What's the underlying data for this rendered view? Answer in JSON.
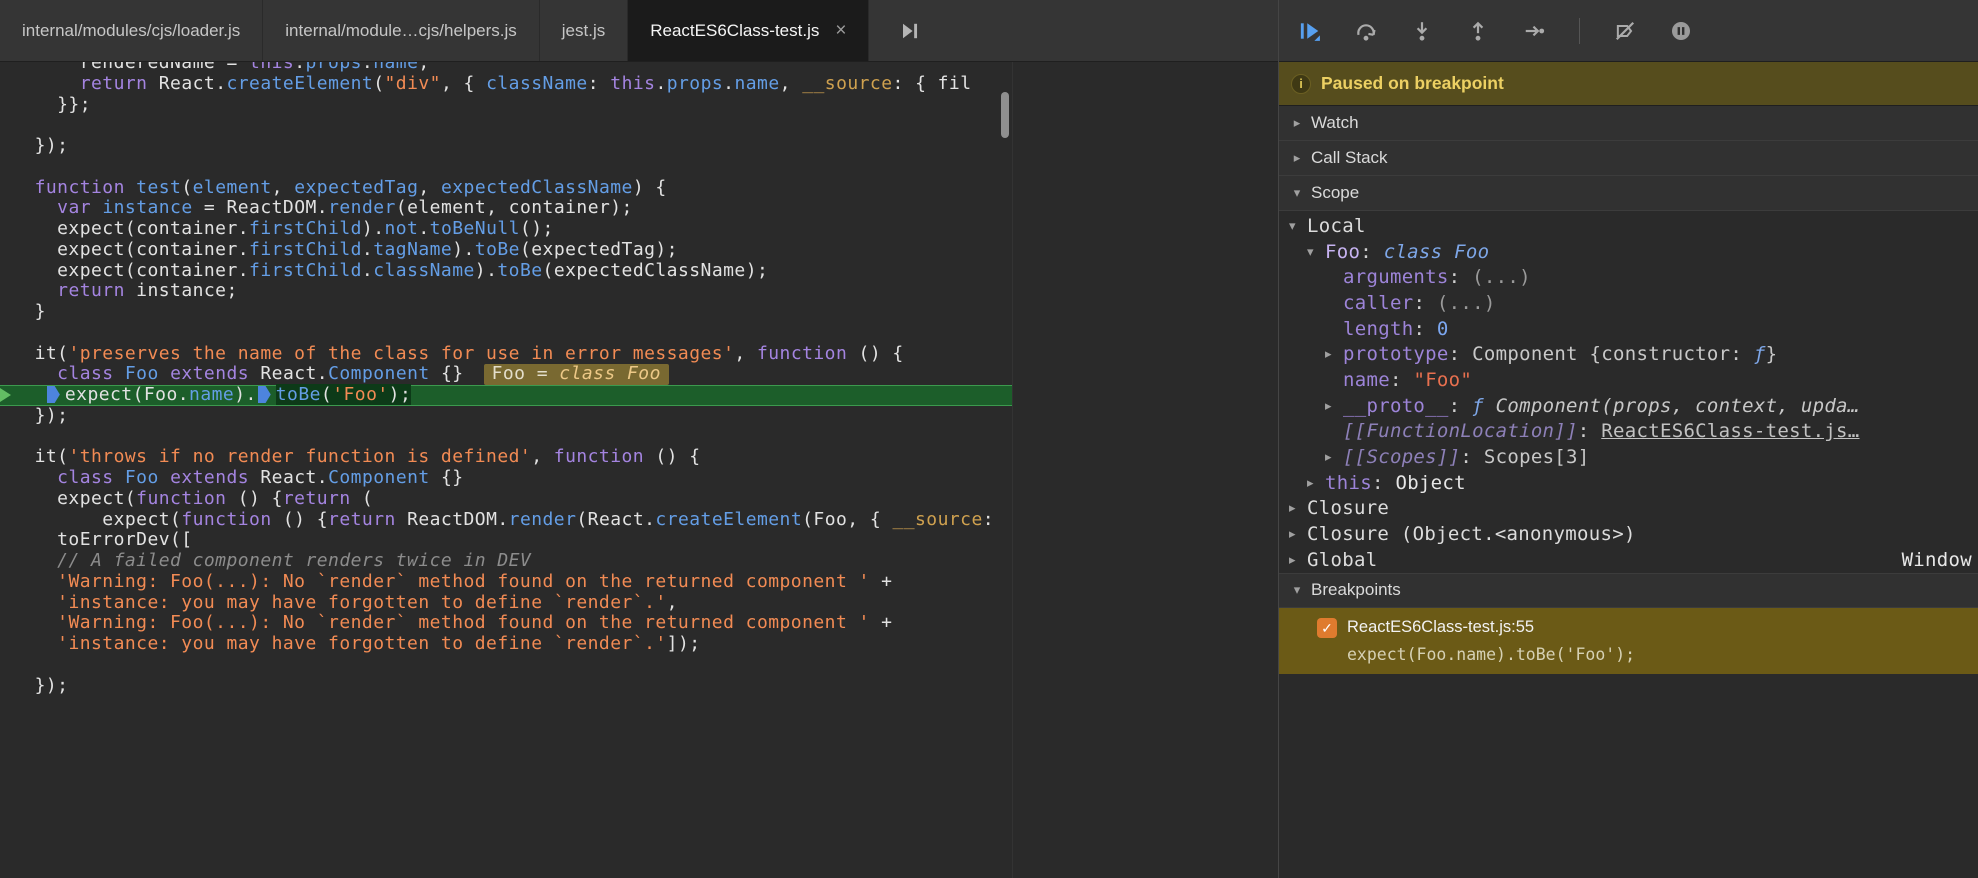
{
  "tabs": [
    {
      "label": "internal/modules/cjs/loader.js",
      "active": false,
      "closable": false
    },
    {
      "label": "internal/module…cjs/helpers.js",
      "active": false,
      "closable": false
    },
    {
      "label": "jest.js",
      "active": false,
      "closable": false
    },
    {
      "label": "ReactES6Class-test.js",
      "active": true,
      "closable": true
    }
  ],
  "tabstrip": {
    "overflow_icon": "more-tabs-icon",
    "close_glyph": "×"
  },
  "editor": {
    "lines": [
      {
        "tokens": [
          [
            "d",
            "      renderedName = "
          ],
          [
            "k",
            "this"
          ],
          [
            "d",
            "."
          ],
          [
            "p",
            "props"
          ],
          [
            "d",
            "."
          ],
          [
            "p",
            "name"
          ],
          [
            "d",
            ";"
          ]
        ]
      },
      {
        "tokens": [
          [
            "d",
            "      "
          ],
          [
            "k",
            "return"
          ],
          [
            "d",
            " React."
          ],
          [
            "p",
            "createElement"
          ],
          [
            "d",
            "("
          ],
          [
            "s",
            "\"div\""
          ],
          [
            "d",
            ", { "
          ],
          [
            "p",
            "className"
          ],
          [
            "d",
            ": "
          ],
          [
            "k",
            "this"
          ],
          [
            "d",
            "."
          ],
          [
            "p",
            "props"
          ],
          [
            "d",
            "."
          ],
          [
            "p",
            "name"
          ],
          [
            "d",
            ", "
          ],
          [
            "t",
            "__source"
          ],
          [
            "d",
            ": { fil"
          ]
        ]
      },
      {
        "tokens": [
          [
            "d",
            "    }};"
          ]
        ]
      },
      {
        "tokens": []
      },
      {
        "tokens": [
          [
            "d",
            "  });"
          ]
        ]
      },
      {
        "tokens": []
      },
      {
        "tokens": [
          [
            "d",
            "  "
          ],
          [
            "k",
            "function"
          ],
          [
            "d",
            " "
          ],
          [
            "p",
            "test"
          ],
          [
            "d",
            "("
          ],
          [
            "p",
            "element"
          ],
          [
            "d",
            ", "
          ],
          [
            "p",
            "expectedTag"
          ],
          [
            "d",
            ", "
          ],
          [
            "p",
            "expectedClassName"
          ],
          [
            "d",
            ") {"
          ]
        ]
      },
      {
        "tokens": [
          [
            "d",
            "    "
          ],
          [
            "k",
            "var"
          ],
          [
            "d",
            " "
          ],
          [
            "p",
            "instance"
          ],
          [
            "d",
            " = ReactDOM."
          ],
          [
            "p",
            "render"
          ],
          [
            "d",
            "(element, container);"
          ]
        ]
      },
      {
        "tokens": [
          [
            "d",
            "    expect(container."
          ],
          [
            "p",
            "firstChild"
          ],
          [
            "d",
            ")."
          ],
          [
            "p",
            "not"
          ],
          [
            "d",
            "."
          ],
          [
            "p",
            "toBeNull"
          ],
          [
            "d",
            "();"
          ]
        ]
      },
      {
        "tokens": [
          [
            "d",
            "    expect(container."
          ],
          [
            "p",
            "firstChild"
          ],
          [
            "d",
            "."
          ],
          [
            "p",
            "tagName"
          ],
          [
            "d",
            ")."
          ],
          [
            "p",
            "toBe"
          ],
          [
            "d",
            "(expectedTag);"
          ]
        ]
      },
      {
        "tokens": [
          [
            "d",
            "    expect(container."
          ],
          [
            "p",
            "firstChild"
          ],
          [
            "d",
            "."
          ],
          [
            "p",
            "className"
          ],
          [
            "d",
            ")."
          ],
          [
            "p",
            "toBe"
          ],
          [
            "d",
            "(expectedClassName);"
          ]
        ]
      },
      {
        "tokens": [
          [
            "d",
            "    "
          ],
          [
            "k",
            "return"
          ],
          [
            "d",
            " instance;"
          ]
        ]
      },
      {
        "tokens": [
          [
            "d",
            "  }"
          ]
        ]
      },
      {
        "tokens": []
      },
      {
        "tokens": [
          [
            "d",
            "  it("
          ],
          [
            "s",
            "'preserves the name of the class for use in error messages'"
          ],
          [
            "d",
            ", "
          ],
          [
            "k",
            "function"
          ],
          [
            "d",
            " () {"
          ]
        ]
      },
      {
        "tokens": [
          [
            "d",
            "    "
          ],
          [
            "k",
            "class"
          ],
          [
            "d",
            " "
          ],
          [
            "p",
            "Foo"
          ],
          [
            "d",
            " "
          ],
          [
            "k",
            "extends"
          ],
          [
            "d",
            " React."
          ],
          [
            "p",
            "Component"
          ],
          [
            "d",
            " {}"
          ]
        ],
        "widget": [
          [
            "wd",
            "Foo = "
          ],
          [
            "wi",
            "class Foo"
          ]
        ]
      },
      {
        "exec": true,
        "tokens": [
          [
            "d",
            "   "
          ],
          [
            "m",
            ""
          ],
          [
            "d",
            "expect(Foo."
          ],
          [
            "p",
            "name"
          ],
          [
            "d",
            ")."
          ],
          [
            "m",
            ""
          ],
          [
            "xp",
            "toBe"
          ],
          [
            "xd",
            "("
          ],
          [
            "xs",
            "'Foo'"
          ],
          [
            "xd",
            ");"
          ]
        ]
      },
      {
        "tokens": [
          [
            "d",
            "  });"
          ]
        ]
      },
      {
        "tokens": []
      },
      {
        "tokens": [
          [
            "d",
            "  it("
          ],
          [
            "s",
            "'throws if no render function is defined'"
          ],
          [
            "d",
            ", "
          ],
          [
            "k",
            "function"
          ],
          [
            "d",
            " () {"
          ]
        ]
      },
      {
        "tokens": [
          [
            "d",
            "    "
          ],
          [
            "k",
            "class"
          ],
          [
            "d",
            " "
          ],
          [
            "p",
            "Foo"
          ],
          [
            "d",
            " "
          ],
          [
            "k",
            "extends"
          ],
          [
            "d",
            " React."
          ],
          [
            "p",
            "Component"
          ],
          [
            "d",
            " {}"
          ]
        ]
      },
      {
        "tokens": [
          [
            "d",
            "    expect("
          ],
          [
            "k",
            "function"
          ],
          [
            "d",
            " () {"
          ],
          [
            "k",
            "return"
          ],
          [
            "d",
            " ("
          ]
        ]
      },
      {
        "tokens": [
          [
            "d",
            "        expect("
          ],
          [
            "k",
            "function"
          ],
          [
            "d",
            " () {"
          ],
          [
            "k",
            "return"
          ],
          [
            "d",
            " ReactDOM."
          ],
          [
            "p",
            "render"
          ],
          [
            "d",
            "(React."
          ],
          [
            "p",
            "createElement"
          ],
          [
            "d",
            "(Foo, { "
          ],
          [
            "t",
            "__source"
          ],
          [
            "d",
            ":"
          ]
        ]
      },
      {
        "tokens": [
          [
            "d",
            "    toErrorDev(["
          ]
        ]
      },
      {
        "tokens": [
          [
            "d",
            "    "
          ],
          [
            "c",
            "// A failed component renders twice in DEV"
          ]
        ]
      },
      {
        "tokens": [
          [
            "d",
            "    "
          ],
          [
            "s",
            "'Warning: Foo(...): No `render` method found on the returned component '"
          ],
          [
            "d",
            " +"
          ]
        ]
      },
      {
        "tokens": [
          [
            "d",
            "    "
          ],
          [
            "s",
            "'instance: you may have forgotten to define `render`.'"
          ],
          [
            "d",
            ","
          ]
        ]
      },
      {
        "tokens": [
          [
            "d",
            "    "
          ],
          [
            "s",
            "'Warning: Foo(...): No `render` method found on the returned component '"
          ],
          [
            "d",
            " +"
          ]
        ]
      },
      {
        "tokens": [
          [
            "d",
            "    "
          ],
          [
            "s",
            "'instance: you may have forgotten to define `render`.'"
          ],
          [
            "d",
            "]);"
          ]
        ]
      },
      {
        "tokens": []
      },
      {
        "tokens": [
          [
            "d",
            "  });"
          ]
        ]
      }
    ]
  },
  "debugger": {
    "toolbar_icons": [
      "resume-icon",
      "step-over-icon",
      "step-into-icon",
      "step-out-icon",
      "step-icon",
      "separator",
      "deactivate-breakpoints-icon",
      "pause-on-exceptions-icon"
    ],
    "paused_banner": {
      "icon": "info-icon",
      "text": "Paused on breakpoint"
    },
    "sections": {
      "watch": "Watch",
      "call_stack": "Call Stack",
      "scope": "Scope",
      "breakpoints": "Breakpoints"
    },
    "scope_rows": [
      {
        "arrow": "down",
        "indent": 0,
        "segments": [
          [
            "sec",
            "Local"
          ]
        ]
      },
      {
        "arrow": "down",
        "indent": 1,
        "segments": [
          [
            "vname",
            "Foo"
          ],
          [
            "d",
            ": "
          ],
          [
            "itblue",
            "class Foo"
          ]
        ]
      },
      {
        "arrow": null,
        "indent": 2,
        "segments": [
          [
            "prop",
            "arguments"
          ],
          [
            "d",
            ": "
          ],
          [
            "dim",
            "(...)"
          ]
        ]
      },
      {
        "arrow": null,
        "indent": 2,
        "segments": [
          [
            "prop",
            "caller"
          ],
          [
            "d",
            ": "
          ],
          [
            "dim",
            "(...)"
          ]
        ]
      },
      {
        "arrow": null,
        "indent": 2,
        "segments": [
          [
            "prop",
            "length"
          ],
          [
            "d",
            ": "
          ],
          [
            "num",
            "0"
          ]
        ]
      },
      {
        "arrow": "right",
        "indent": 2,
        "segments": [
          [
            "prop",
            "prototype"
          ],
          [
            "d",
            ": "
          ],
          [
            "val",
            "Component {constructor: "
          ],
          [
            "fn",
            "ƒ"
          ],
          [
            "val",
            "}"
          ]
        ]
      },
      {
        "arrow": null,
        "indent": 2,
        "segments": [
          [
            "prop",
            "name"
          ],
          [
            "d",
            ": "
          ],
          [
            "str",
            "\"Foo\""
          ]
        ]
      },
      {
        "arrow": "right",
        "indent": 2,
        "segments": [
          [
            "prop",
            "__proto__"
          ],
          [
            "d",
            ": "
          ],
          [
            "fn",
            "ƒ "
          ],
          [
            "fnp",
            "Component(props, context, upda…"
          ]
        ]
      },
      {
        "arrow": null,
        "indent": 2,
        "segments": [
          [
            "iprop",
            "[[FunctionLocation]]"
          ],
          [
            "d",
            ": "
          ],
          [
            "link",
            "ReactES6Class-test.js…"
          ]
        ]
      },
      {
        "arrow": "right",
        "indent": 2,
        "segments": [
          [
            "iprop",
            "[[Scopes]]"
          ],
          [
            "d",
            ": "
          ],
          [
            "val",
            "Scopes[3]"
          ]
        ]
      },
      {
        "arrow": "right",
        "indent": 1,
        "segments": [
          [
            "prop",
            "this"
          ],
          [
            "d",
            ": "
          ],
          [
            "valw",
            "Object"
          ]
        ]
      },
      {
        "arrow": "right",
        "indent": 0,
        "segments": [
          [
            "sec",
            "Closure"
          ]
        ]
      },
      {
        "arrow": "right",
        "indent": 0,
        "segments": [
          [
            "sec",
            "Closure (Object.<anonymous>)"
          ]
        ]
      },
      {
        "arrow": "right",
        "indent": 0,
        "segments": [
          [
            "sec",
            "Global"
          ]
        ],
        "right_value": "Window"
      }
    ],
    "breakpoint": {
      "checked": true,
      "check_glyph": "✓",
      "location": "ReactES6Class-test.js:55",
      "code": "expect(Foo.name).toBe('Foo');"
    }
  },
  "colors": {
    "accent_blue": "#57a0f0",
    "marker_blue": "#4d84dd",
    "exec_line_green": "#1c5e2a",
    "banner_bg": "#564d1d",
    "breakpoint_bg": "#6b5a16",
    "checkbox_orange": "#df7b2e"
  }
}
